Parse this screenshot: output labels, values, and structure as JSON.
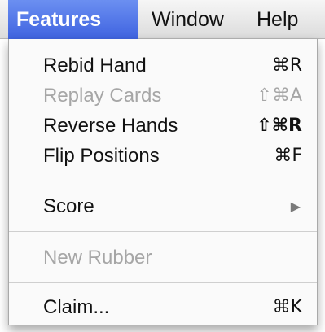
{
  "menubar": {
    "items": [
      {
        "label": "Features",
        "active": true
      },
      {
        "label": "Window",
        "active": false
      },
      {
        "label": "Help",
        "active": false
      }
    ]
  },
  "menu": {
    "items": [
      {
        "label": "Rebid Hand",
        "shortcut": "⌘R",
        "enabled": true
      },
      {
        "label": "Replay Cards",
        "shortcut": "⇧⌘A",
        "enabled": false
      },
      {
        "label": "Reverse Hands",
        "shortcut": "⇧⌘R",
        "enabled": true
      },
      {
        "label": "Flip Positions",
        "shortcut": "⌘F",
        "enabled": true
      },
      {
        "label": "Score",
        "submenu_icon": "triangle-right-icon",
        "enabled": true
      },
      {
        "label": "New Rubber",
        "enabled": false
      },
      {
        "label": "Claim...",
        "shortcut": "⌘K",
        "enabled": true
      }
    ]
  },
  "colors": {
    "highlight": "#4a6ee6",
    "disabled_text": "#a6a6a6",
    "text": "#111111"
  }
}
